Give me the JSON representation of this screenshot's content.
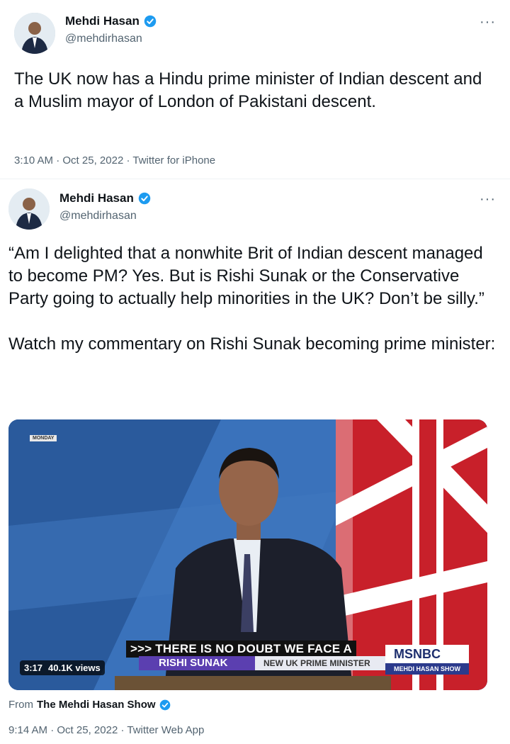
{
  "tweets": [
    {
      "display_name": "Mehdi Hasan",
      "handle": "@mehdirhasan",
      "more_label": "···",
      "text": "The UK now has a Hindu prime minister of Indian descent and a Muslim mayor of London of Pakistani descent.",
      "time": "3:10 AM",
      "date": "Oct 25, 2022",
      "separator": "·",
      "source": "Twitter for iPhone"
    },
    {
      "display_name": "Mehdi Hasan",
      "handle": "@mehdirhasan",
      "more_label": "···",
      "text": "“Am I delighted that a nonwhite Brit of Indian descent managed to become PM? Yes. But is Rishi Sunak or the Conservative Party going to actually help minorities in the UK? Don’t be silly.”\n\nWatch my commentary on Rishi Sunak becoming prime minister:",
      "video": {
        "tag": "MONDAY",
        "caption": ">>> THERE IS NO DOUBT WE FACE A",
        "lower_third_name": "RISHI SUNAK",
        "lower_third_title": "NEW UK PRIME MINISTER",
        "network": "MSNBC",
        "show": "MEHDI HASAN SHOW",
        "duration": "3:17",
        "views": "40.1K views"
      },
      "from_prefix": "From",
      "from_show": "The Mehdi Hasan Show",
      "time": "9:14 AM",
      "date": "Oct 25, 2022",
      "separator": "·",
      "source": "Twitter Web App"
    }
  ],
  "colors": {
    "verified_blue": "#1d9bf0",
    "secondary_text": "#536471",
    "primary_text": "#0f1419",
    "msnbc_purple": "#5b3fb0",
    "backdrop_blue": "#2f63a8"
  },
  "icons": {
    "verified": "verified-badge-icon",
    "more": "more-options-icon"
  }
}
